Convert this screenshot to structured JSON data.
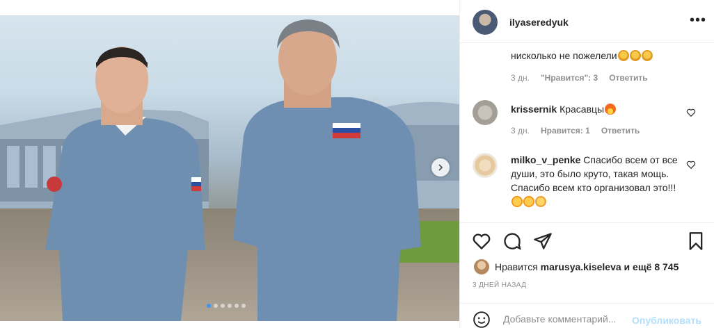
{
  "post": {
    "author": "ilyaseredyuk",
    "more_label": "•••",
    "carousel": {
      "total_slides": 6,
      "active_slide": 1
    }
  },
  "comments": [
    {
      "id": "c0",
      "username": "",
      "text": "нисколько не пожелели",
      "emojis": [
        "raising-hands",
        "raising-hands",
        "raising-hands"
      ],
      "time": "3 дн.",
      "likes": "\"Нравится\": 3",
      "reply": "Ответить"
    },
    {
      "id": "c1",
      "username": "krissernik",
      "text": "Красавцы",
      "emojis": [
        "fire"
      ],
      "time": "3 дн.",
      "likes": "Нравится: 1",
      "reply": "Ответить"
    },
    {
      "id": "c2",
      "username": "milko_v_penke",
      "text": "Спасибо всем от все души, это было круто, такая мощь. Спасибо всем кто организовал это!!!",
      "emojis": [
        "star-struck",
        "star-struck",
        "clapping-hands"
      ]
    }
  ],
  "actions": {
    "liked_by_prefix": "Нравится",
    "liked_by_user": "marusya.kiseleva",
    "liked_by_suffix": "и ещё 8 745",
    "date": "3 ДНЕЙ НАЗАД"
  },
  "composer": {
    "placeholder": "Добавьте комментарий...",
    "post_label": "Опубликовать"
  },
  "colors": {
    "text": "#262626",
    "muted": "#8e8e8e",
    "border": "#efefef",
    "accent": "#3897f0",
    "post_disabled": "#b2dffc"
  }
}
